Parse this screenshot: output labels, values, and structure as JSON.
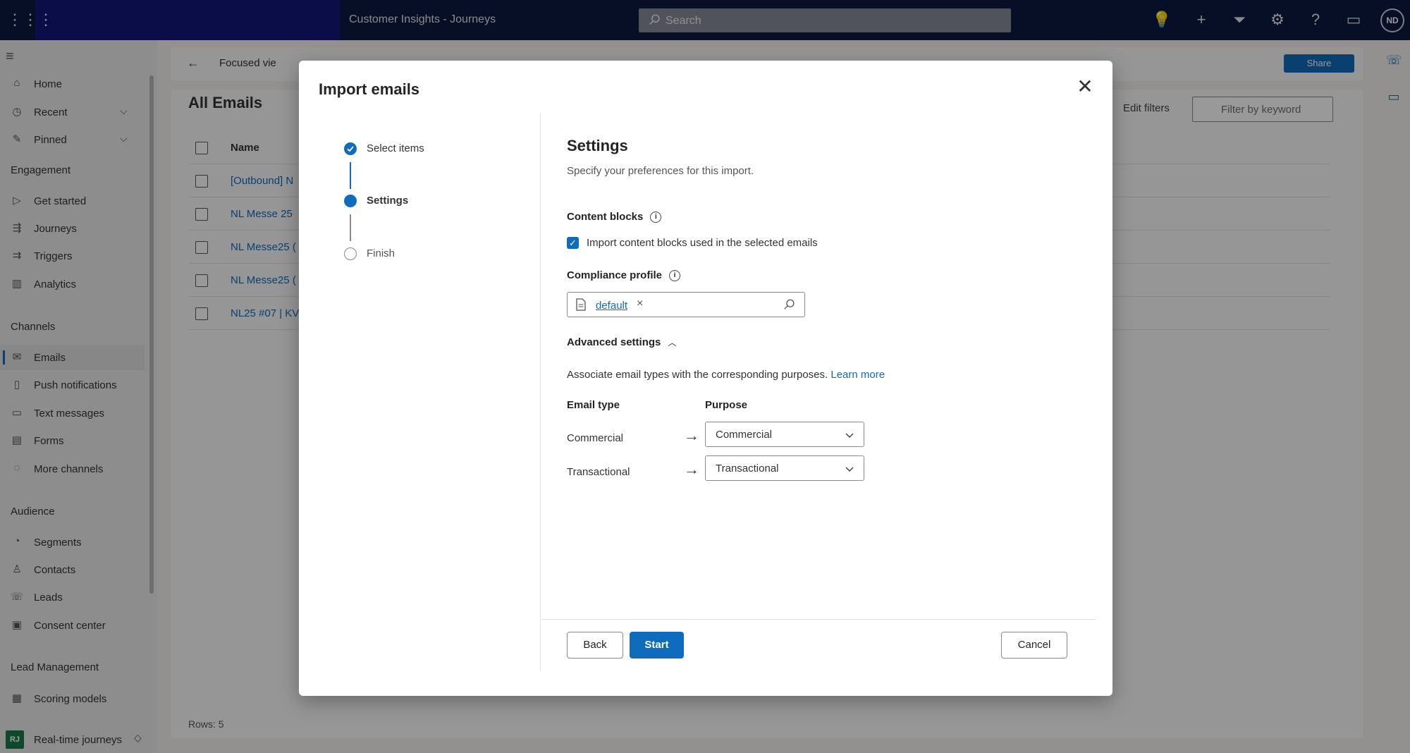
{
  "topbar": {
    "app_title": "Customer Insights - Journeys",
    "search_placeholder": "Search",
    "avatar_initials": "ND"
  },
  "sidebar": {
    "items": [
      {
        "label": "Home",
        "icon": "home-icon"
      },
      {
        "label": "Recent",
        "icon": "clock-icon"
      },
      {
        "label": "Pinned",
        "icon": "pin-icon"
      }
    ],
    "groups": [
      {
        "title": "Engagement",
        "items": [
          "Get started",
          "Journeys",
          "Triggers",
          "Analytics"
        ]
      },
      {
        "title": "Channels",
        "items": [
          "Emails",
          "Push notifications",
          "Text messages",
          "Forms",
          "More channels"
        ]
      },
      {
        "title": "Audience",
        "items": [
          "Segments",
          "Contacts",
          "Leads",
          "Consent center"
        ]
      },
      {
        "title": "Lead Management",
        "items": [
          "Scoring models"
        ]
      }
    ],
    "area": {
      "badge": "RJ",
      "label": "Real-time journeys"
    }
  },
  "main": {
    "focused_view": "Focused vie",
    "share": "Share",
    "view_title": "All Emails",
    "edit_filters": "Edit filters",
    "filter_placeholder": "Filter by keyword",
    "col_name": "Name",
    "rows": [
      "[Outbound] N",
      "NL Messe 25",
      "NL Messe25 (",
      "NL Messe25 (",
      "NL25 #07 | KV"
    ],
    "rows_count": "Rows: 5"
  },
  "dialog": {
    "title": "Import emails",
    "steps": [
      {
        "label": "Select items",
        "state": "done"
      },
      {
        "label": "Settings",
        "state": "current"
      },
      {
        "label": "Finish",
        "state": "todo"
      }
    ],
    "heading": "Settings",
    "subheading": "Specify your preferences for this import.",
    "content_blocks_label": "Content blocks",
    "import_blocks_checkbox": "Import content blocks used in the selected emails",
    "import_blocks_checked": true,
    "compliance_label": "Compliance profile",
    "compliance_value": "default",
    "advanced_label": "Advanced settings",
    "associate_text": "Associate email types with the corresponding purposes.",
    "learn_more": "Learn more",
    "email_type_header": "Email type",
    "purpose_header": "Purpose",
    "mappings": [
      {
        "type": "Commercial",
        "purpose": "Commercial"
      },
      {
        "type": "Transactional",
        "purpose": "Transactional"
      }
    ],
    "back": "Back",
    "start": "Start",
    "cancel": "Cancel"
  },
  "colors": {
    "accent": "#0f6cbd",
    "topbar": "#0b1a3e"
  }
}
